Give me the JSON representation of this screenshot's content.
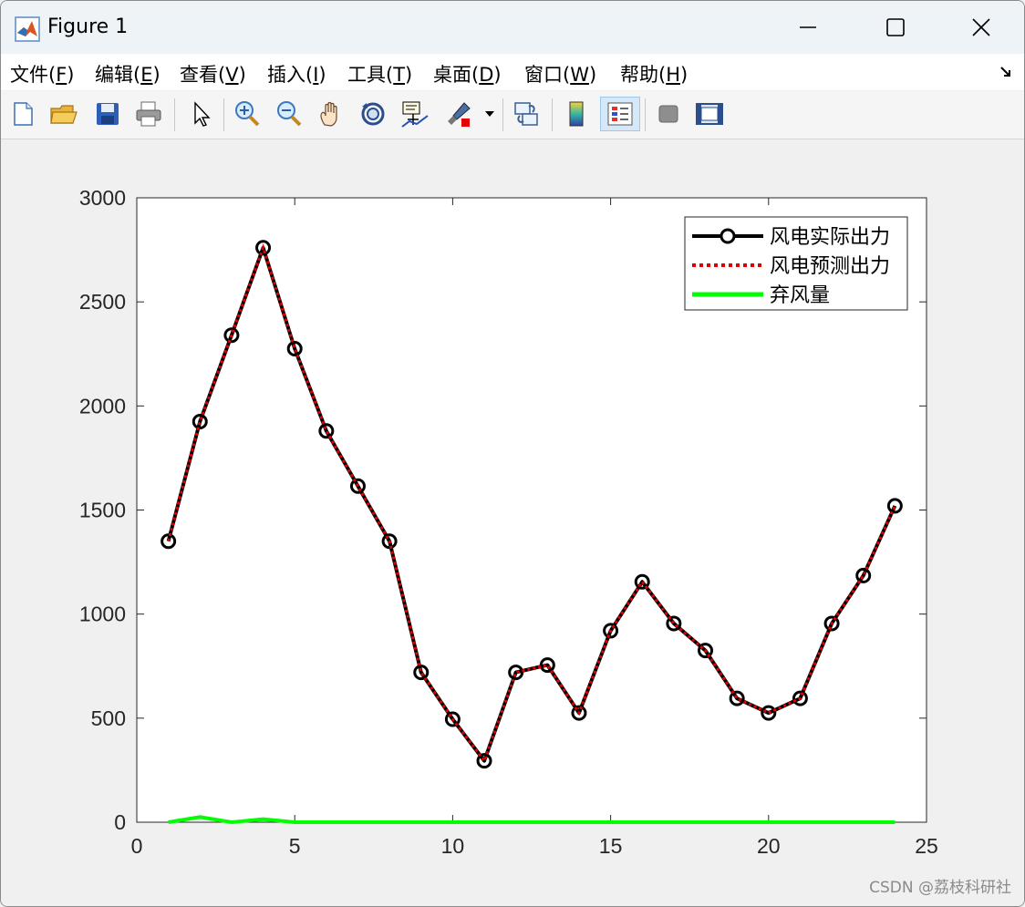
{
  "window": {
    "title": "Figure 1"
  },
  "menu": [
    {
      "label": "文件(",
      "acc": "F",
      "end": ")"
    },
    {
      "label": "编辑(",
      "acc": "E",
      "end": ")"
    },
    {
      "label": "查看(",
      "acc": "V",
      "end": ")"
    },
    {
      "label": "插入(",
      "acc": "I",
      "end": ")"
    },
    {
      "label": "工具(",
      "acc": "T",
      "end": ")"
    },
    {
      "label": "桌面(",
      "acc": "D",
      "end": ")"
    },
    {
      "label": "窗口(",
      "acc": "W",
      "end": ")"
    },
    {
      "label": "帮助(",
      "acc": "H",
      "end": ")"
    }
  ],
  "toolbar_icons": [
    "new-file-icon",
    "open-folder-icon",
    "save-icon",
    "print-icon",
    "pointer-icon",
    "zoom-in-icon",
    "zoom-out-icon",
    "pan-hand-icon",
    "rotate-3d-icon",
    "data-cursor-icon",
    "brush-icon",
    "link-icon",
    "colorbar-icon",
    "legend-icon",
    "hide-plot-tools-icon",
    "show-plot-tools-icon"
  ],
  "watermark": "CSDN @荔枝科研社",
  "colors": {
    "actual": "#000000",
    "forecast": "#e00000",
    "curtail": "#00ff00"
  },
  "chart_data": {
    "type": "line",
    "xlim": [
      0,
      25
    ],
    "ylim": [
      0,
      3000
    ],
    "xticks": [
      0,
      5,
      10,
      15,
      20,
      25
    ],
    "yticks": [
      0,
      500,
      1000,
      1500,
      2000,
      2500,
      3000
    ],
    "grid": false,
    "legend_position": "top-right",
    "x": [
      1,
      2,
      3,
      4,
      5,
      6,
      7,
      8,
      9,
      10,
      11,
      12,
      13,
      14,
      15,
      16,
      17,
      18,
      19,
      20,
      21,
      22,
      23,
      24
    ],
    "series": [
      {
        "name": "风电实际出力",
        "style": "solid-circle",
        "values": [
          1350,
          1925,
          2340,
          2760,
          2275,
          1880,
          1615,
          1350,
          720,
          495,
          295,
          720,
          755,
          525,
          920,
          1155,
          955,
          825,
          595,
          525,
          595,
          955,
          1185,
          1520
        ]
      },
      {
        "name": "风电预测出力",
        "style": "dotted",
        "values": [
          1350,
          1925,
          2340,
          2760,
          2275,
          1880,
          1615,
          1350,
          720,
          495,
          295,
          720,
          755,
          525,
          920,
          1155,
          955,
          825,
          595,
          525,
          595,
          955,
          1185,
          1520
        ]
      },
      {
        "name": "弃风量",
        "style": "solid",
        "values": [
          0,
          25,
          0,
          15,
          0,
          0,
          0,
          0,
          0,
          0,
          0,
          0,
          0,
          0,
          0,
          0,
          0,
          0,
          0,
          0,
          0,
          0,
          0,
          0
        ]
      }
    ]
  }
}
